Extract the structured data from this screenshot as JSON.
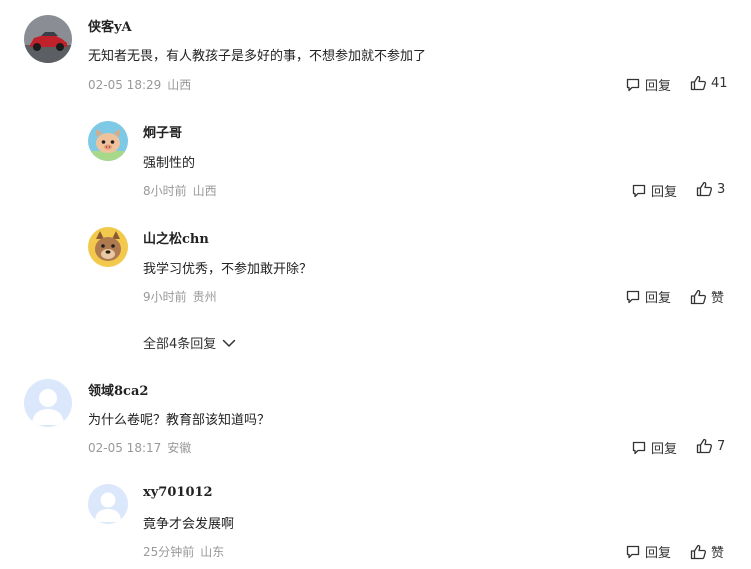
{
  "reply_label": "回复",
  "like_label": "赞",
  "comments": [
    {
      "username": "侠客yA",
      "text": "无知者无畏，有人教孩子是多好的事，不想参加就不参加了",
      "time": "02-05 18:29",
      "location": "山西",
      "likes": "41"
    },
    {
      "username": "炯子哥",
      "text": "强制性的",
      "time": "8小时前",
      "location": "山西",
      "likes": "3"
    },
    {
      "username": "山之松chn",
      "text": "我学习优秀，不参加敢开除？",
      "time": "9小时前",
      "location": "贵州",
      "likes": "赞"
    },
    {
      "username": "领域8ca2",
      "text": "为什么卷呢？教育部该知道吗？",
      "time": "02-05 18:17",
      "location": "安徽",
      "likes": "7"
    },
    {
      "username": "xy701012",
      "text": "竟争才会发展啊",
      "time": "25分钟前",
      "location": "山东",
      "likes": "赞"
    }
  ],
  "expand_replies": "全部4条回复",
  "icons": [
    "comment-icon",
    "thumbs-up-icon",
    "chevron-down-icon"
  ]
}
